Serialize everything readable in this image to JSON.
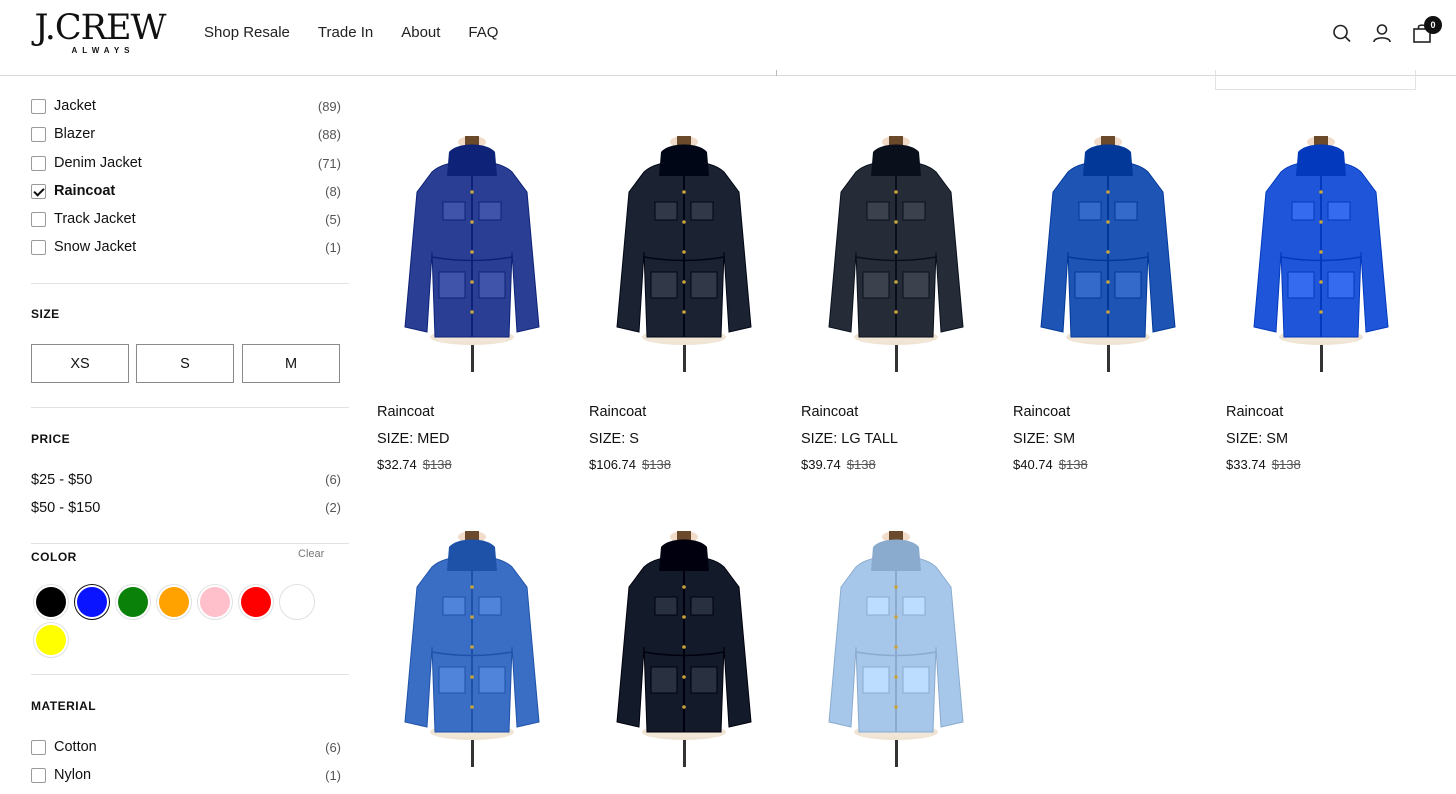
{
  "header": {
    "logo_main": "J.CREW",
    "logo_sub": "ALWAYS",
    "nav": [
      "Shop Resale",
      "Trade In",
      "About",
      "FAQ"
    ],
    "cart_count": "0",
    "icons": [
      "search-icon",
      "account-icon",
      "cart-icon"
    ]
  },
  "filters": {
    "category": [
      {
        "label": "Jacket",
        "count": "(89)",
        "checked": false
      },
      {
        "label": "Blazer",
        "count": "(88)",
        "checked": false
      },
      {
        "label": "Denim Jacket",
        "count": "(71)",
        "checked": false
      },
      {
        "label": "Raincoat",
        "count": "(8)",
        "checked": true
      },
      {
        "label": "Track Jacket",
        "count": "(5)",
        "checked": false
      },
      {
        "label": "Snow Jacket",
        "count": "(1)",
        "checked": false
      }
    ],
    "size": {
      "title": "SIZE",
      "options": [
        "XS",
        "S",
        "M"
      ]
    },
    "price": {
      "title": "PRICE",
      "options": [
        {
          "label": "$25 - $50",
          "count": "(6)"
        },
        {
          "label": "$50 - $150",
          "count": "(2)"
        }
      ]
    },
    "color": {
      "title": "COLOR",
      "clear": "Clear",
      "swatches": [
        {
          "name": "black",
          "hex": "#000000",
          "selected": false
        },
        {
          "name": "blue",
          "hex": "#0a14ff",
          "selected": true
        },
        {
          "name": "green",
          "hex": "#0a820a",
          "selected": false
        },
        {
          "name": "orange",
          "hex": "#ffa200",
          "selected": false
        },
        {
          "name": "pink",
          "hex": "#ffbfcb",
          "selected": false
        },
        {
          "name": "red",
          "hex": "#ff0000",
          "selected": false
        },
        {
          "name": "white",
          "hex": "#ffffff",
          "selected": false
        },
        {
          "name": "yellow",
          "hex": "#ffff00",
          "selected": false
        }
      ]
    },
    "material": {
      "title": "MATERIAL",
      "options": [
        {
          "label": "Cotton",
          "count": "(6)",
          "checked": false
        },
        {
          "label": "Nylon",
          "count": "(1)",
          "checked": false
        }
      ]
    }
  },
  "products": [
    {
      "title": "Raincoat",
      "size": "SIZE: MED",
      "price": "$32.74",
      "orig": "$138",
      "color": "#2a3f93"
    },
    {
      "title": "Raincoat",
      "size": "SIZE: S",
      "price": "$106.74",
      "orig": "$138",
      "color": "#1b2232"
    },
    {
      "title": "Raincoat",
      "size": "SIZE: LG TALL",
      "price": "$39.74",
      "orig": "$138",
      "color": "#252c38"
    },
    {
      "title": "Raincoat",
      "size": "SIZE: SM",
      "price": "$40.74",
      "orig": "$138",
      "color": "#1e55b5"
    },
    {
      "title": "Raincoat",
      "size": "SIZE: SM",
      "price": "$33.74",
      "orig": "$138",
      "color": "#1f55d8"
    },
    {
      "title": "",
      "size": "",
      "price": "",
      "orig": "",
      "color": "#3a6ec4"
    },
    {
      "title": "",
      "size": "",
      "price": "",
      "orig": "",
      "color": "#131a2a"
    },
    {
      "title": "",
      "size": "",
      "price": "",
      "orig": "",
      "color": "#a6c7ea"
    }
  ]
}
